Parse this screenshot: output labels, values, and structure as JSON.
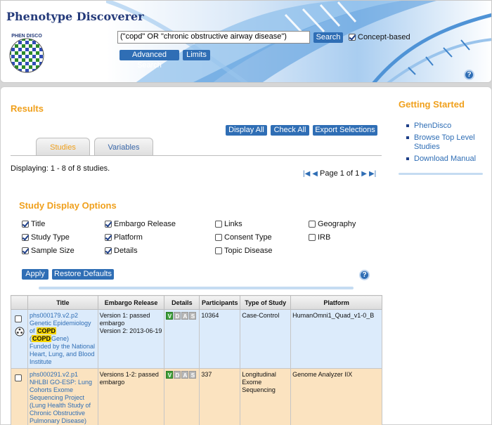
{
  "header": {
    "app_title": "Phenotype Discoverer",
    "logo_text": "PHEN DISCO",
    "search_value": "(\"copd\" OR \"chronic obstructive airway disease\")",
    "search_button": "Search",
    "concept_label": "Concept-based",
    "concept_checked": true,
    "advanced_search": "Advanced Search",
    "limits": "Limits",
    "help": "?"
  },
  "results": {
    "title": "Results",
    "buttons": [
      "Display All",
      "Check All",
      "Export Selections"
    ],
    "tabs": [
      "Studies",
      "Variables"
    ],
    "active_tab": "Studies",
    "displaying": "Displaying: 1 - 8 of 8 studies.",
    "pager": "Page 1 of 1"
  },
  "options": {
    "title": "Study Display Options",
    "items": [
      {
        "label": "Title",
        "checked": true
      },
      {
        "label": "Embargo Release",
        "checked": true
      },
      {
        "label": "Links",
        "checked": false
      },
      {
        "label": "Geography",
        "checked": false
      },
      {
        "label": "Study Type",
        "checked": true
      },
      {
        "label": "Platform",
        "checked": true
      },
      {
        "label": "Consent Type",
        "checked": false
      },
      {
        "label": "IRB",
        "checked": false
      },
      {
        "label": "Sample Size",
        "checked": true
      },
      {
        "label": "Details",
        "checked": true
      },
      {
        "label": "Topic Disease",
        "checked": false
      }
    ],
    "apply": "Apply",
    "restore": "Restore Defaults",
    "help": "?"
  },
  "table": {
    "headers": [
      "Title",
      "Embargo Release",
      "Details",
      "Participants",
      "Type of Study",
      "Platform"
    ],
    "detail_letters": [
      "V",
      "D",
      "A",
      "S"
    ],
    "rows": [
      {
        "id": "phs000179.v2.p2",
        "title_a": "Genetic Epidemiology of ",
        "title_hl1": "COPD",
        "title_b": " (",
        "title_hl2": "COPD",
        "title_c": "Gene)",
        "funded": "Funded by the National Heart, Lung, and Blood Institute",
        "embargo": "Version 1: passed embargo\nVersion 2: 2013-06-19",
        "participants": "10364",
        "type": "Case-Control",
        "platform": "HumanOmni1_Quad_v1-0_B"
      },
      {
        "id": "phs000291.v2.p1",
        "title_a": "NHLBI GO-ESP: Lung Cohorts Exome Sequencing Project (Lung Health Study of Chronic Obstructive Pulmonary Disease)",
        "embargo": "Versions 1-2: passed embargo",
        "participants": "337",
        "type": "Longitudinal Exome Sequencing",
        "platform": "Genome Analyzer IIX"
      }
    ]
  },
  "sidebar": {
    "title": "Getting Started",
    "links": [
      "PhenDisco",
      "Browse Top Level Studies",
      "Download Manual"
    ]
  },
  "colors": {
    "accent_orange": "#f0a01c",
    "button_blue": "#2f6eb5",
    "row_blue": "#dcebfb",
    "row_tan": "#fbe3c0"
  }
}
